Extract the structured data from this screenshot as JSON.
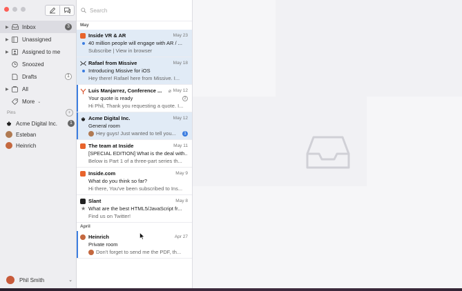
{
  "sidebar": {
    "nav": [
      {
        "label": "Inbox",
        "badge": "3",
        "active": true,
        "icon": "inbox-icon",
        "caret": true
      },
      {
        "label": "Unassigned",
        "icon": "unassigned-icon",
        "caret": true
      },
      {
        "label": "Assigned to me",
        "icon": "user-icon",
        "caret": true
      },
      {
        "label": "Snoozed",
        "icon": "clock-icon",
        "caret": false
      },
      {
        "label": "Drafts",
        "badge": "1",
        "icon": "drafts-icon",
        "caret": false
      },
      {
        "label": "All",
        "icon": "all-icon",
        "caret": true
      },
      {
        "label": "More",
        "icon": "tag-icon",
        "caret": false
      }
    ],
    "pins_label": "Pins",
    "pins": [
      {
        "label": "Acme Digital Inc.",
        "badge": "1"
      },
      {
        "label": "Esteban"
      },
      {
        "label": "Heinrich"
      }
    ],
    "user_name": "Phil Smith"
  },
  "search": {
    "placeholder": "Search"
  },
  "sections": {
    "may": "May",
    "april": "April"
  },
  "conversations": [
    {
      "sender": "Inside VR & AR",
      "date": "May 23",
      "subject": "40 million people will engage with AR / ...",
      "snippet": "Subscribe | View in browser"
    },
    {
      "sender": "Rafael from Missive",
      "date": "May 18",
      "subject": "Introducing Missive for iOS",
      "snippet": "Hey there! Rafael here from Missive. I..."
    },
    {
      "sender": "Luis Manjarrez, Conference ...",
      "date": "May 12",
      "subject": "Your quote is ready",
      "snippet": "Hi Phil, Thank you requesting a quote. I..."
    },
    {
      "sender": "Acme Digital Inc.",
      "date": "May 12",
      "subject": "General room",
      "snippet": "Hey guys! Just wanted to tell you...",
      "count": "1"
    },
    {
      "sender": "The team at Inside",
      "date": "May 11",
      "subject": "[SPECIAL EDITION] What is the deal with...",
      "snippet": "Below is Part 1 of a three-part series th..."
    },
    {
      "sender": "Inside.com",
      "date": "May 9",
      "subject": "What do you think so far?",
      "snippet": "Hi there, You've been subscribed to Ins..."
    },
    {
      "sender": "Slant",
      "date": "May 8",
      "subject": "What are the best HTML5/JavaScript fr...",
      "snippet": "Find us on Twitter!"
    },
    {
      "sender": "Heinrich",
      "date": "Apr 27",
      "subject": "Private room",
      "snippet": "Don't forget to send me the PDF, th..."
    }
  ]
}
